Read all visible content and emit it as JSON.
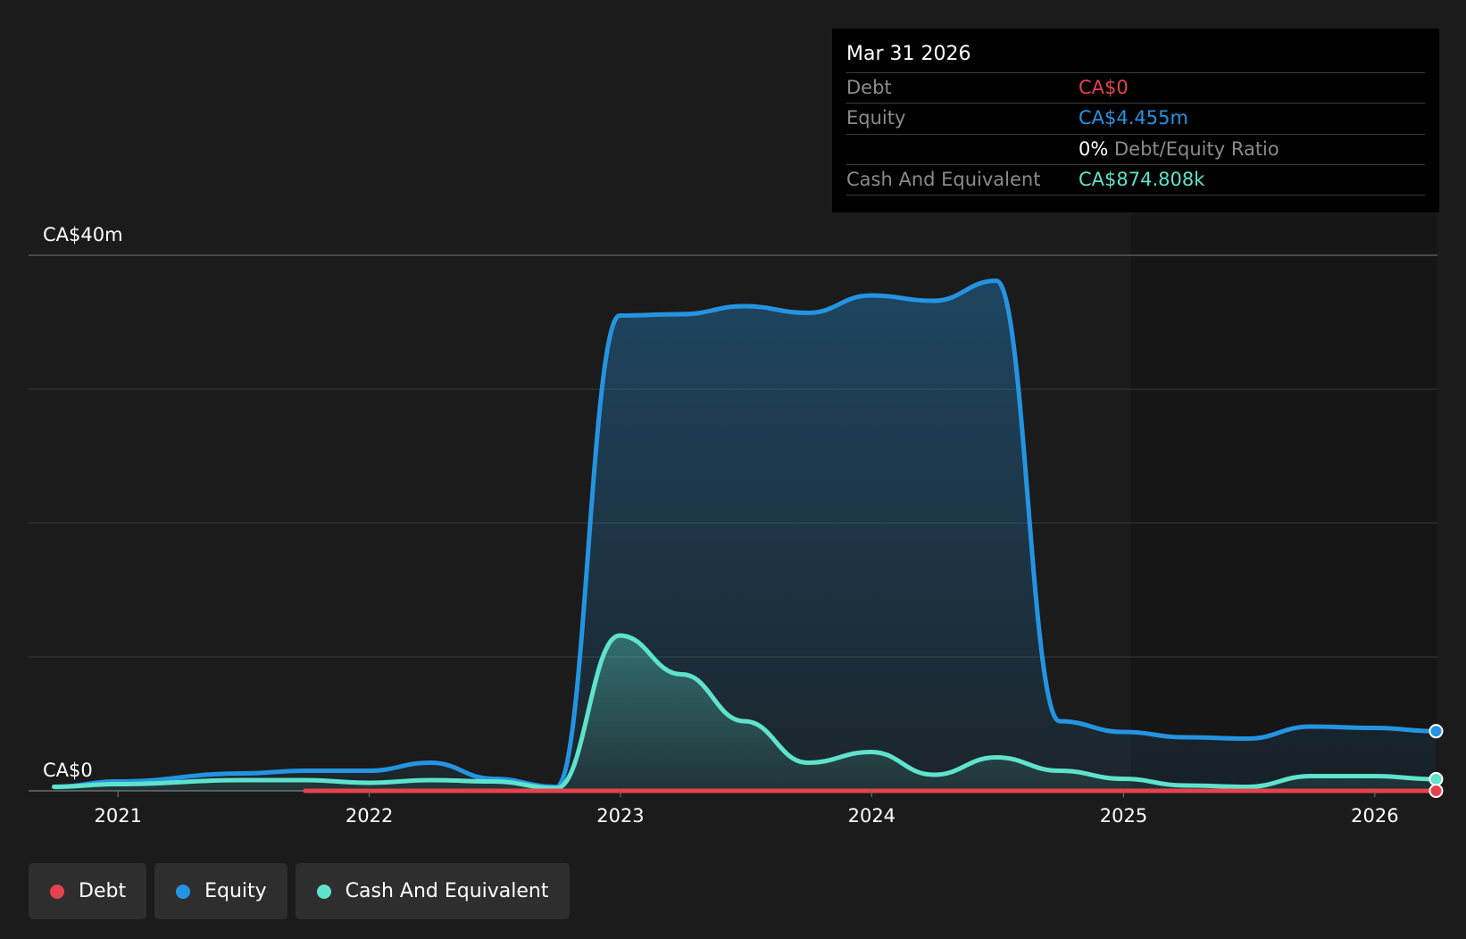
{
  "colors": {
    "background": "#1b1b1b",
    "debt": "#e5424d",
    "equity": "#2494e2",
    "cash": "#5ee3cc",
    "grid": "#3a3a3a",
    "tooltip_bg": "#000000"
  },
  "tooltip": {
    "date": "Mar 31 2026",
    "debt_label": "Debt",
    "debt_value": "CA$0",
    "equity_label": "Equity",
    "equity_value": "CA$4.455m",
    "ratio_value": "0%",
    "ratio_label": "Debt/Equity Ratio",
    "cash_label": "Cash And Equivalent",
    "cash_value": "CA$874.808k"
  },
  "legend": {
    "items": [
      {
        "label": "Debt",
        "color": "#e5424d",
        "icon": "circle-dot-icon"
      },
      {
        "label": "Equity",
        "color": "#2494e2",
        "icon": "circle-dot-icon"
      },
      {
        "label": "Cash And Equivalent",
        "color": "#5ee3cc",
        "icon": "circle-dot-icon"
      }
    ]
  },
  "chart_data": {
    "type": "area",
    "title": "",
    "xlabel": "",
    "ylabel": "",
    "y_axis_labels": [
      "CA$40m",
      "CA$0"
    ],
    "ylim": [
      0,
      40
    ],
    "y_unit": "CA$ millions",
    "y_gridlines": [
      0,
      10,
      20,
      30,
      40
    ],
    "x_range": [
      "2020-08-24",
      "2026-04-02"
    ],
    "x_ticks": [
      "2021",
      "2022",
      "2023",
      "2024",
      "2025",
      "2026"
    ],
    "grid": true,
    "legend_position": "bottom-left",
    "series": [
      {
        "name": "Equity",
        "x": [
          "2020-09-30",
          "2021-01-01",
          "2021-06-30",
          "2021-09-30",
          "2021-12-31",
          "2022-03-31",
          "2022-06-30",
          "2022-09-30",
          "2022-12-31",
          "2023-03-31",
          "2023-06-30",
          "2023-09-30",
          "2023-12-31",
          "2024-03-31",
          "2024-06-30",
          "2024-09-30",
          "2024-12-31",
          "2025-03-31",
          "2025-06-30",
          "2025-09-30",
          "2025-12-31",
          "2026-03-31"
        ],
        "values": [
          0.3,
          0.7,
          1.3,
          1.5,
          1.5,
          2.1,
          0.9,
          0.3,
          35.5,
          35.6,
          36.2,
          35.7,
          37.0,
          36.6,
          38.1,
          5.2,
          4.4,
          4.0,
          3.9,
          4.8,
          4.7,
          4.455
        ]
      },
      {
        "name": "Cash And Equivalent",
        "x": [
          "2020-09-30",
          "2021-01-01",
          "2021-06-30",
          "2021-09-30",
          "2021-12-31",
          "2022-03-31",
          "2022-06-30",
          "2022-09-30",
          "2022-12-31",
          "2023-03-31",
          "2023-06-30",
          "2023-09-30",
          "2023-12-31",
          "2024-03-31",
          "2024-06-30",
          "2024-09-30",
          "2024-12-31",
          "2025-03-31",
          "2025-06-30",
          "2025-09-30",
          "2025-12-31",
          "2026-03-31"
        ],
        "values": [
          0.3,
          0.5,
          0.8,
          0.8,
          0.6,
          0.8,
          0.7,
          0.2,
          11.6,
          8.7,
          5.2,
          2.1,
          2.9,
          1.2,
          2.5,
          1.5,
          0.9,
          0.4,
          0.3,
          1.1,
          1.1,
          0.874808
        ]
      },
      {
        "name": "Debt",
        "x": [
          "2021-09-30",
          "2026-03-31"
        ],
        "values": [
          0,
          0
        ]
      }
    ]
  }
}
